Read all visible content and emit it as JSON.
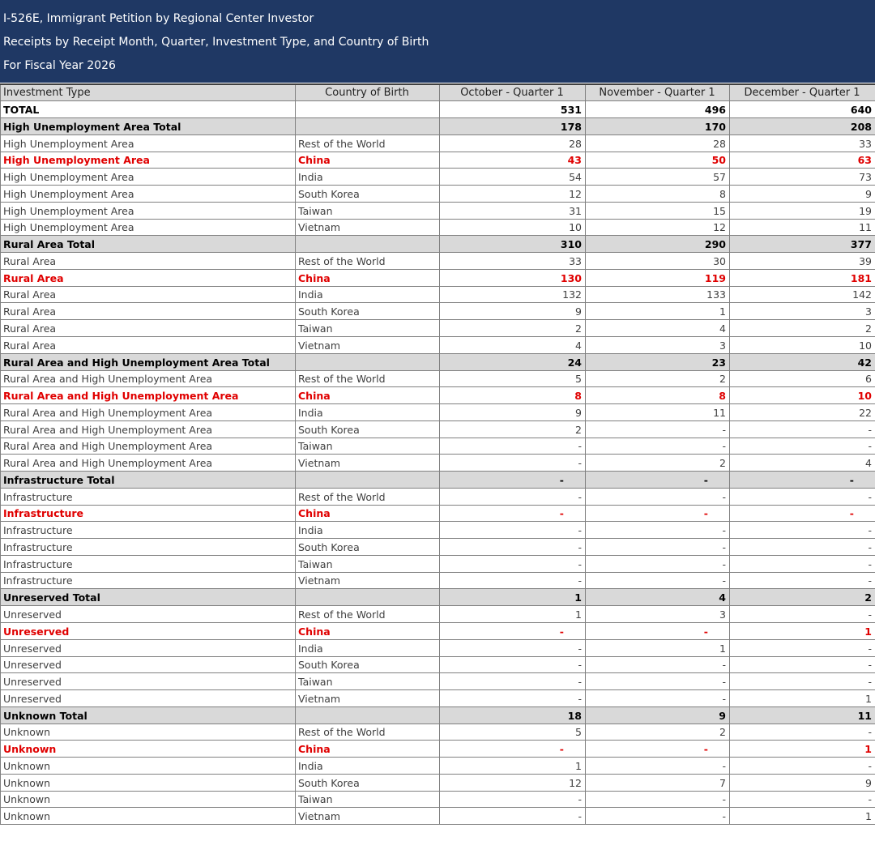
{
  "header": {
    "title": "I-526E, Immigrant Petition by Regional Center Investor",
    "subtitle": "Receipts by Receipt Month, Quarter, Investment Type, and Country of Birth",
    "fiscal_year": "For Fiscal Year 2026"
  },
  "colors": {
    "header_bg": "#1f3864",
    "group_bg": "#d9d9d9",
    "highlight": "#e00000"
  },
  "table": {
    "columns": [
      "Investment Type",
      "Country of Birth",
      "October - Quarter 1",
      "November - Quarter 1",
      "December - Quarter 1"
    ],
    "rows": [
      {
        "kind": "total",
        "type": "TOTAL",
        "country": "",
        "values": [
          "531",
          "496",
          "640"
        ]
      },
      {
        "kind": "group",
        "type": "High Unemployment Area Total",
        "country": "",
        "values": [
          "178",
          "170",
          "208"
        ]
      },
      {
        "kind": "row",
        "type": "High Unemployment Area",
        "country": "Rest of the World",
        "values": [
          "28",
          "28",
          "33"
        ]
      },
      {
        "kind": "china",
        "type": "High Unemployment Area",
        "country": "China",
        "values": [
          "43",
          "50",
          "63"
        ]
      },
      {
        "kind": "row",
        "type": "High Unemployment Area",
        "country": "India",
        "values": [
          "54",
          "57",
          "73"
        ]
      },
      {
        "kind": "row",
        "type": "High Unemployment Area",
        "country": "South Korea",
        "values": [
          "12",
          "8",
          "9"
        ]
      },
      {
        "kind": "row",
        "type": "High Unemployment Area",
        "country": "Taiwan",
        "values": [
          "31",
          "15",
          "19"
        ]
      },
      {
        "kind": "row",
        "type": "High Unemployment Area",
        "country": "Vietnam",
        "values": [
          "10",
          "12",
          "11"
        ]
      },
      {
        "kind": "group",
        "type": "Rural Area Total",
        "country": "",
        "values": [
          "310",
          "290",
          "377"
        ]
      },
      {
        "kind": "row",
        "type": "Rural Area",
        "country": "Rest of the World",
        "values": [
          "33",
          "30",
          "39"
        ]
      },
      {
        "kind": "china",
        "type": "Rural Area",
        "country": "China",
        "values": [
          "130",
          "119",
          "181"
        ]
      },
      {
        "kind": "row",
        "type": "Rural Area",
        "country": "India",
        "values": [
          "132",
          "133",
          "142"
        ]
      },
      {
        "kind": "row",
        "type": "Rural Area",
        "country": "South Korea",
        "values": [
          "9",
          "1",
          "3"
        ]
      },
      {
        "kind": "row",
        "type": "Rural Area",
        "country": "Taiwan",
        "values": [
          "2",
          "4",
          "2"
        ]
      },
      {
        "kind": "row",
        "type": "Rural Area",
        "country": "Vietnam",
        "values": [
          "4",
          "3",
          "10"
        ]
      },
      {
        "kind": "group",
        "type": "Rural Area and High Unemployment Area Total",
        "country": "",
        "values": [
          "24",
          "23",
          "42"
        ]
      },
      {
        "kind": "row",
        "type": "Rural Area and High Unemployment Area",
        "country": "Rest of the World",
        "values": [
          "5",
          "2",
          "6"
        ]
      },
      {
        "kind": "china",
        "type": "Rural Area and High Unemployment Area",
        "country": "China",
        "values": [
          "8",
          "8",
          "10"
        ]
      },
      {
        "kind": "row",
        "type": "Rural Area and High Unemployment Area",
        "country": "India",
        "values": [
          "9",
          "11",
          "22"
        ]
      },
      {
        "kind": "row",
        "type": "Rural Area and High Unemployment Area",
        "country": "South Korea",
        "values": [
          "2",
          "-",
          "-"
        ]
      },
      {
        "kind": "row",
        "type": "Rural Area and High Unemployment Area",
        "country": "Taiwan",
        "values": [
          "-",
          "-",
          "-"
        ]
      },
      {
        "kind": "row",
        "type": "Rural Area and High Unemployment Area",
        "country": "Vietnam",
        "values": [
          "-",
          "2",
          "4"
        ]
      },
      {
        "kind": "group",
        "type": "Infrastructure Total",
        "country": "",
        "values": [
          "-",
          "-",
          "-"
        ]
      },
      {
        "kind": "row",
        "type": "Infrastructure",
        "country": "Rest of the World",
        "values": [
          "-",
          "-",
          "-"
        ]
      },
      {
        "kind": "china",
        "type": "Infrastructure",
        "country": "China",
        "values": [
          "-",
          "-",
          "-"
        ]
      },
      {
        "kind": "row",
        "type": "Infrastructure",
        "country": "India",
        "values": [
          "-",
          "-",
          "-"
        ]
      },
      {
        "kind": "row",
        "type": "Infrastructure",
        "country": "South Korea",
        "values": [
          "-",
          "-",
          "-"
        ]
      },
      {
        "kind": "row",
        "type": "Infrastructure",
        "country": "Taiwan",
        "values": [
          "-",
          "-",
          "-"
        ]
      },
      {
        "kind": "row",
        "type": "Infrastructure",
        "country": "Vietnam",
        "values": [
          "-",
          "-",
          "-"
        ]
      },
      {
        "kind": "group",
        "type": "Unreserved Total",
        "country": "",
        "values": [
          "1",
          "4",
          "2"
        ]
      },
      {
        "kind": "row",
        "type": "Unreserved",
        "country": "Rest of the World",
        "values": [
          "1",
          "3",
          "-"
        ]
      },
      {
        "kind": "china",
        "type": "Unreserved",
        "country": "China",
        "values": [
          "-",
          "-",
          "1"
        ]
      },
      {
        "kind": "row",
        "type": "Unreserved",
        "country": "India",
        "values": [
          "-",
          "1",
          "-"
        ]
      },
      {
        "kind": "row",
        "type": "Unreserved",
        "country": "South Korea",
        "values": [
          "-",
          "-",
          "-"
        ]
      },
      {
        "kind": "row",
        "type": "Unreserved",
        "country": "Taiwan",
        "values": [
          "-",
          "-",
          "-"
        ]
      },
      {
        "kind": "row",
        "type": "Unreserved",
        "country": "Vietnam",
        "values": [
          "-",
          "-",
          "1"
        ]
      },
      {
        "kind": "group",
        "type": "Unknown Total",
        "country": "",
        "values": [
          "18",
          "9",
          "11"
        ]
      },
      {
        "kind": "row",
        "type": "Unknown",
        "country": "Rest of the World",
        "values": [
          "5",
          "2",
          "-"
        ]
      },
      {
        "kind": "china",
        "type": "Unknown",
        "country": "China",
        "values": [
          "-",
          "-",
          "1"
        ]
      },
      {
        "kind": "row",
        "type": "Unknown",
        "country": "India",
        "values": [
          "1",
          "-",
          "-"
        ]
      },
      {
        "kind": "row",
        "type": "Unknown",
        "country": "South Korea",
        "values": [
          "12",
          "7",
          "9"
        ]
      },
      {
        "kind": "row",
        "type": "Unknown",
        "country": "Taiwan",
        "values": [
          "-",
          "-",
          "-"
        ]
      },
      {
        "kind": "row",
        "type": "Unknown",
        "country": "Vietnam",
        "values": [
          "-",
          "-",
          "1"
        ]
      }
    ]
  }
}
